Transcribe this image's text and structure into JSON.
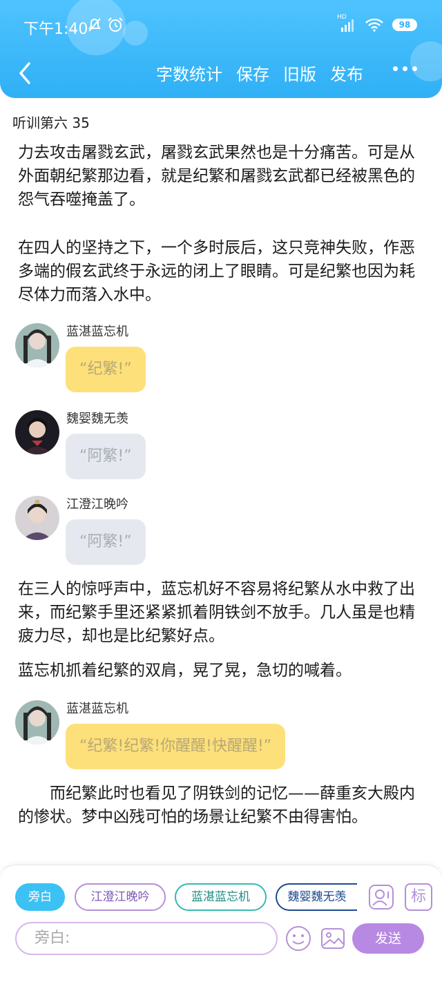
{
  "status_bar": {
    "time": "下午1:40",
    "network": "HD",
    "battery": "98"
  },
  "nav": {
    "actions": [
      "字数统计",
      "保存",
      "旧版",
      "发布"
    ]
  },
  "chapter_title": "听训第六 35",
  "content": {
    "paragraphs": [
      "力去攻击屠戮玄武，屠戮玄武果然也是十分痛苦。可是从外面朝纪繁那边看，就是纪繁和屠戮玄武都已经被黑色的怨气吞噬掩盖了。",
      "在四人的坚持之下，一个多时辰后，这只竞神失败，作恶多端的假玄武终于永远的闭上了眼睛。可是纪繁也因为耗尽体力而落入水中。",
      "在三人的惊呼声中，蓝忘机好不容易将纪繁从水中救了出来，而纪繁手里还紧紧抓着阴铁剑不放手。几人虽是也精疲力尽，却也是比纪繁好点。",
      "蓝忘机抓着纪繁的双肩，晃了晃，急切的喊着。",
      "而纪繁此时也看见了阴铁剑的记忆——薛重亥大殿内的惨状。梦中凶残可怕的场景让纪繁不由得害怕。"
    ],
    "messages": [
      {
        "speaker": "蓝湛蓝忘机",
        "text": "“纪繁!”"
      },
      {
        "speaker": "魏婴魏无羡",
        "text": "“阿繁!”"
      },
      {
        "speaker": "江澄江晚吟",
        "text": "“阿繁!”"
      },
      {
        "speaker": "蓝湛蓝忘机",
        "text": "“纪繁!纪繁!你醒醒!快醒醒!”"
      }
    ]
  },
  "composer": {
    "roles": [
      "旁白",
      "江澄江晚吟",
      "蓝湛蓝忘机",
      "魏婴魏无羡"
    ],
    "tag_label": "标",
    "input_placeholder": "旁白:",
    "send_label": "发送"
  },
  "colors": {
    "header": "#2fb0f5",
    "bubble_yellow": "#fde079",
    "bubble_gray": "#e5e9ef",
    "send": "#b889e3"
  }
}
